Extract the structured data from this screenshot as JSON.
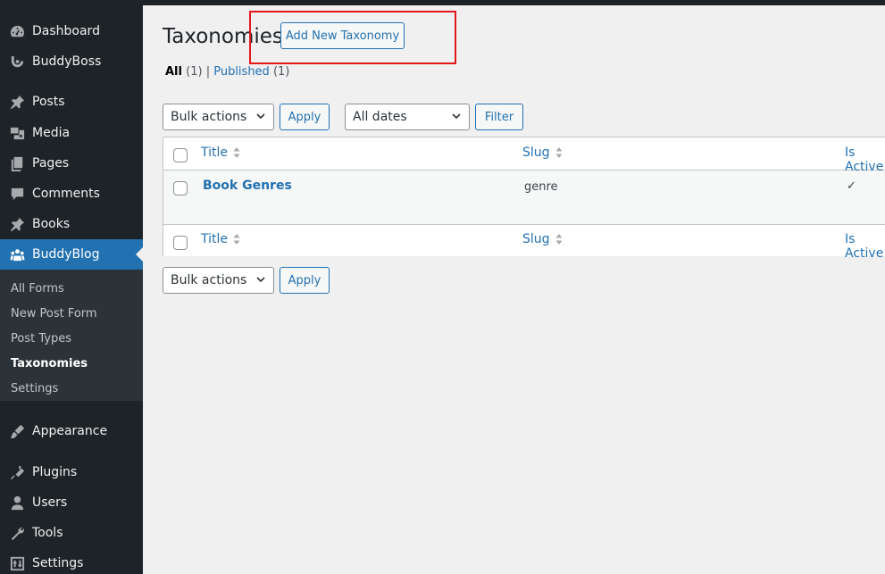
{
  "sidebar": {
    "items": [
      {
        "label": "Dashboard",
        "icon": "dashboard-icon"
      },
      {
        "label": "BuddyBoss",
        "icon": "buddyboss-icon"
      },
      {
        "label": "Posts",
        "icon": "pin-icon"
      },
      {
        "label": "Media",
        "icon": "media-icon"
      },
      {
        "label": "Pages",
        "icon": "pages-icon"
      },
      {
        "label": "Comments",
        "icon": "comments-icon"
      },
      {
        "label": "Books",
        "icon": "pin-icon"
      },
      {
        "label": "BuddyBlog",
        "icon": "buddyblog-icon"
      },
      {
        "label": "Appearance",
        "icon": "appearance-icon"
      },
      {
        "label": "Plugins",
        "icon": "plugins-icon"
      },
      {
        "label": "Users",
        "icon": "users-icon"
      },
      {
        "label": "Tools",
        "icon": "tools-icon"
      },
      {
        "label": "Settings",
        "icon": "settings-icon"
      }
    ],
    "submenu": [
      "All Forms",
      "New Post Form",
      "Post Types",
      "Taxonomies",
      "Settings"
    ],
    "active_submenu": "Taxonomies"
  },
  "page": {
    "title": "Taxonomies",
    "add_new": "Add New Taxonomy"
  },
  "views": {
    "all_label": "All",
    "all_count": "(1)",
    "separator": "|",
    "published_label": "Published",
    "published_count": "(1)"
  },
  "filters": {
    "bulk_actions": "Bulk actions",
    "apply": "Apply",
    "dates": "All dates",
    "filter": "Filter"
  },
  "table": {
    "columns": [
      "Title",
      "Slug",
      "Is Active"
    ],
    "rows": [
      {
        "title": "Book Genres",
        "slug": "genre",
        "active": "✓"
      }
    ]
  },
  "colors": {
    "sidebar_bg": "#1d2327",
    "accent": "#2271b1",
    "highlight": "#e3171b"
  }
}
